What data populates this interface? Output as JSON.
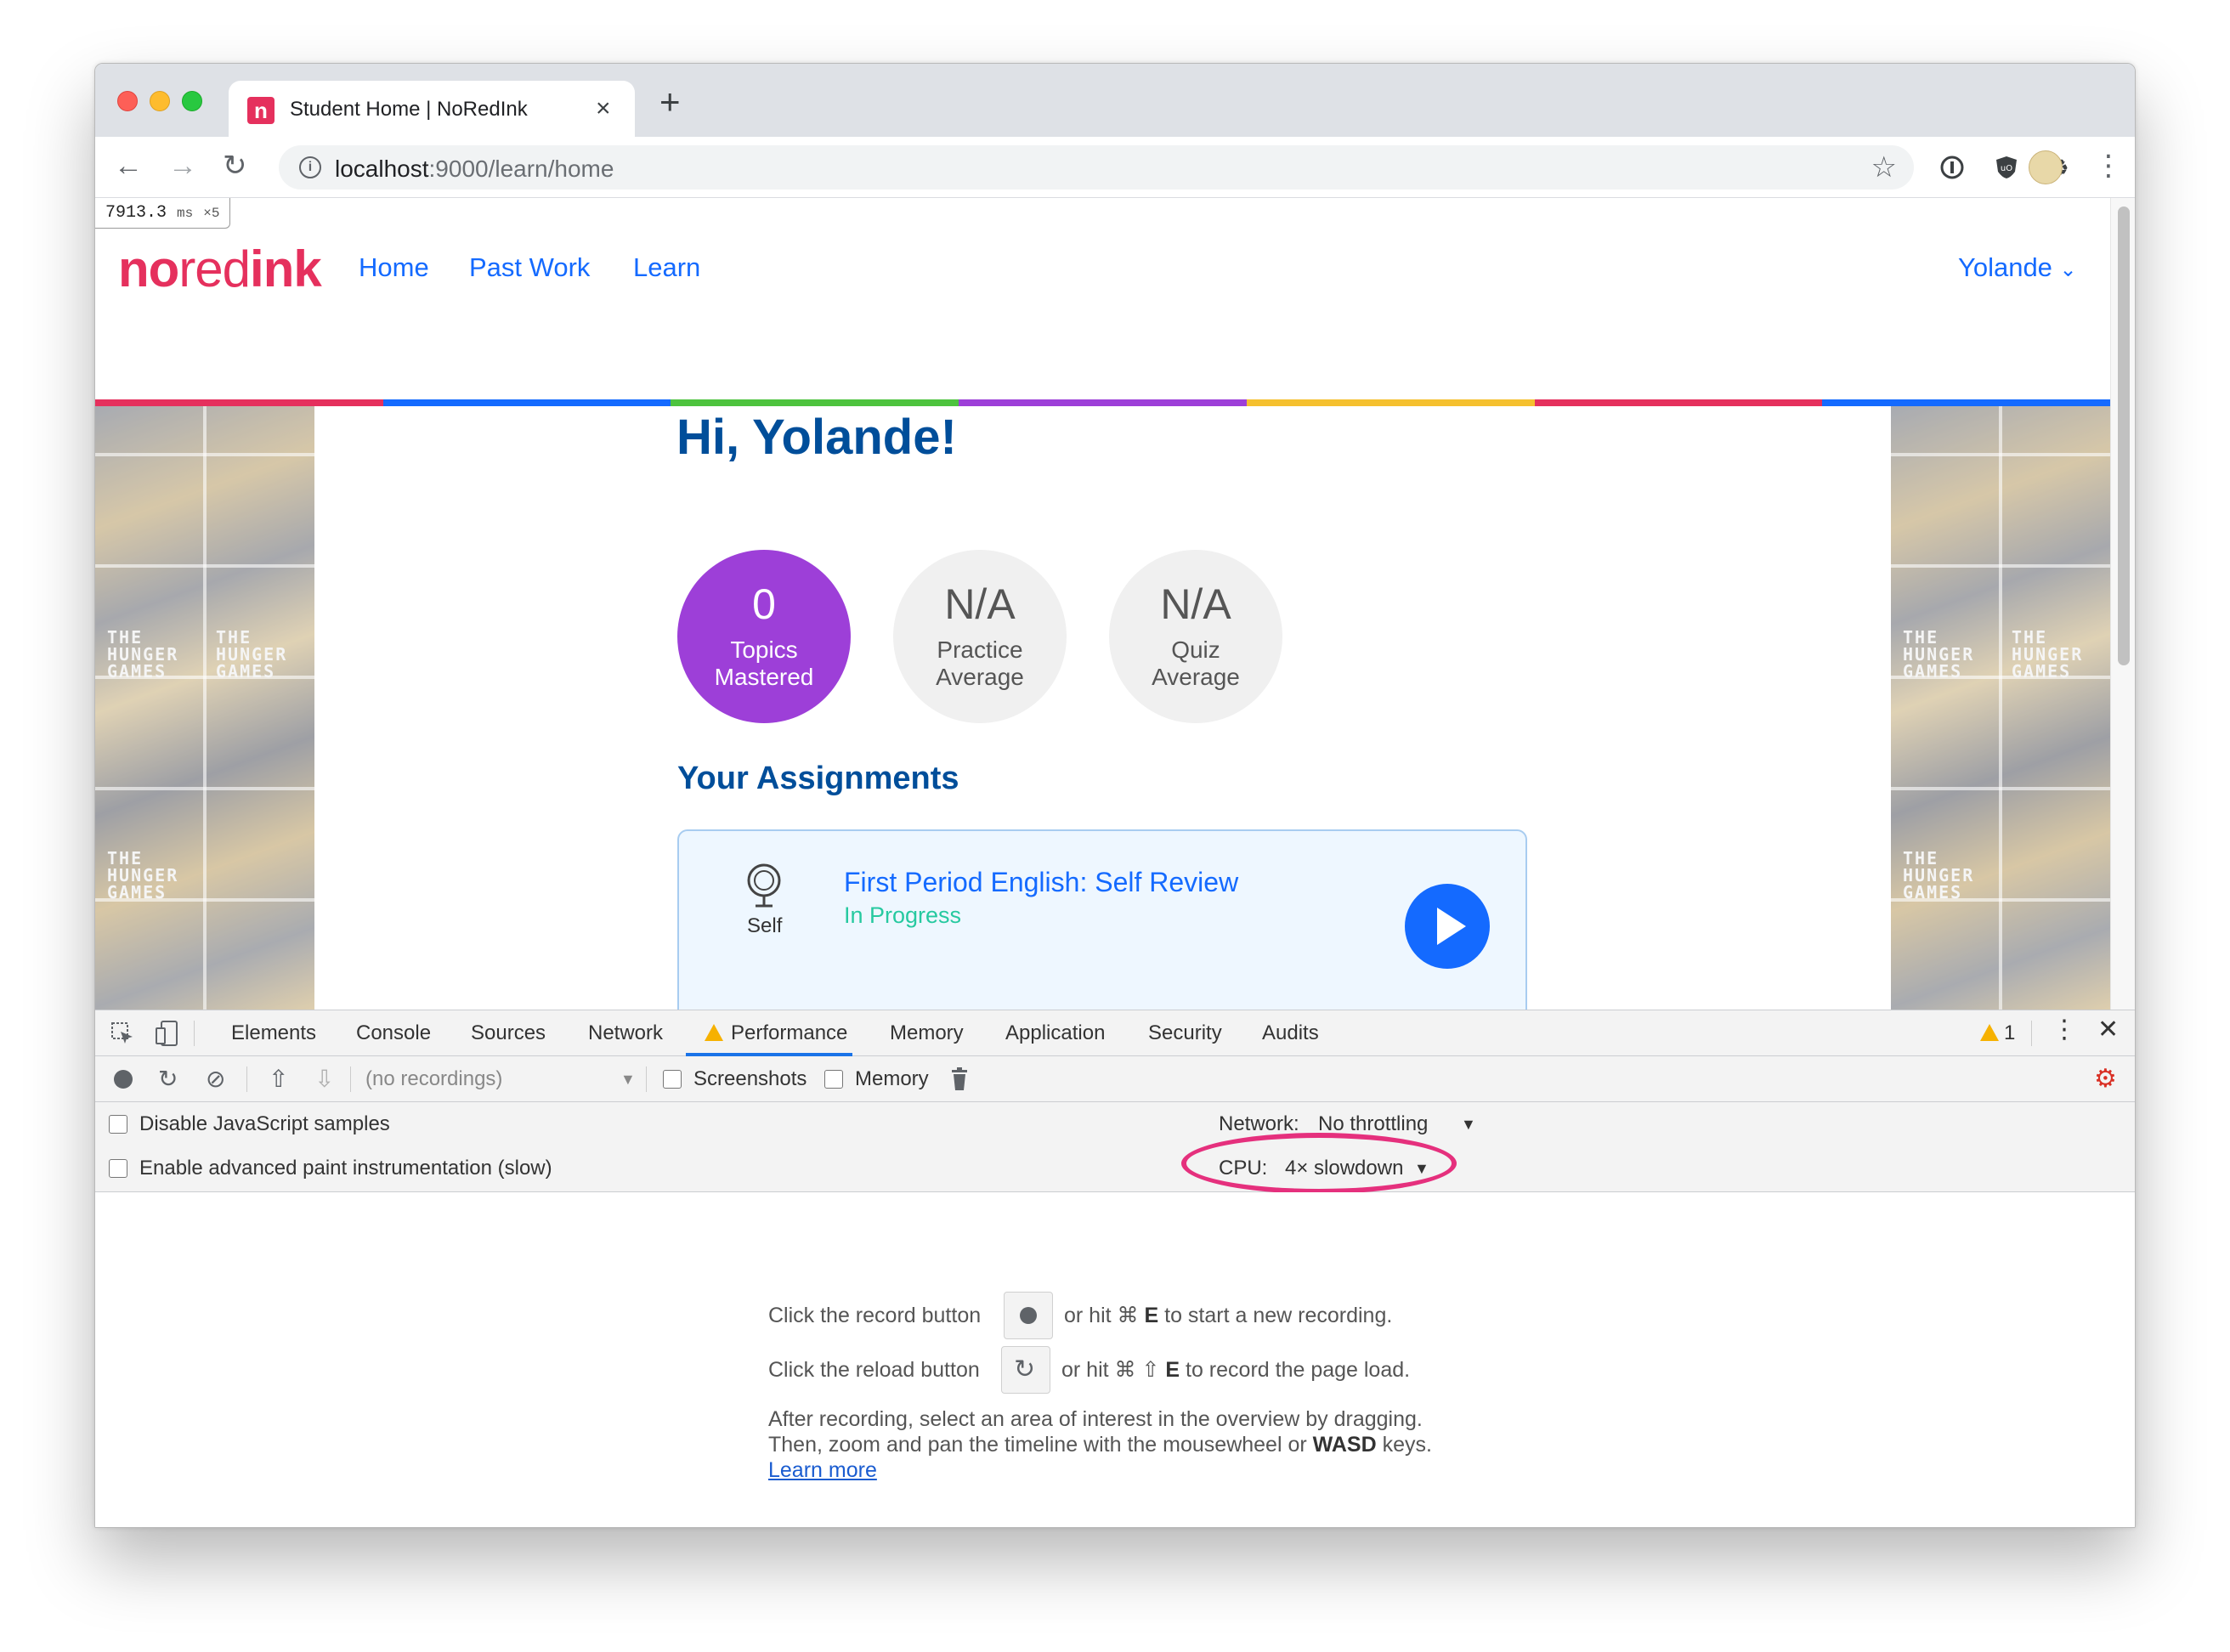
{
  "browser": {
    "tab": {
      "title": "Student Home | NoRedInk",
      "favicon": "n",
      "close": "×"
    },
    "new_tab": "+",
    "url": {
      "host": "localhost",
      "path": ":9000/learn/home"
    }
  },
  "page": {
    "timing": {
      "value": "7913.3",
      "unit": "ms",
      "multiplier": "×5"
    },
    "logo": {
      "part1": "no",
      "part2": "red",
      "part3": "ink"
    },
    "nav": [
      "Home",
      "Past Work",
      "Learn"
    ],
    "user": "Yolande",
    "greeting": "Hi, Yolande!",
    "stats": [
      {
        "value": "0",
        "line1": "Topics",
        "line2": "Mastered",
        "color": "#9d3fd8"
      },
      {
        "value": "N/A",
        "line1": "Practice",
        "line2": "Average",
        "color": "#f0f0f0"
      },
      {
        "value": "N/A",
        "line1": "Quiz",
        "line2": "Average",
        "color": "#f0f0f0"
      }
    ],
    "assignments_title": "Your Assignments",
    "assignment": {
      "type": "Self",
      "title": "First Period English: Self Review",
      "status": "In Progress"
    },
    "side_art": {
      "poster_text_line1": "THE",
      "poster_text_line2": "HUNGER",
      "poster_text_line3": "GAMES"
    },
    "rainbow_colors": [
      "#e5305d",
      "#146aff",
      "#4dc33e",
      "#9d3fd8",
      "#f5c02e",
      "#e5305d",
      "#146aff"
    ]
  },
  "devtools": {
    "tabs": [
      "Elements",
      "Console",
      "Sources",
      "Network",
      "Performance",
      "Memory",
      "Application",
      "Security",
      "Audits"
    ],
    "active_tab": "Performance",
    "warnings_count": "1",
    "recordings_placeholder": "(no recordings)",
    "screenshots_label": "Screenshots",
    "memory_label": "Memory",
    "settings": {
      "disable_js_samples": "Disable JavaScript samples",
      "advanced_paint": "Enable advanced paint instrumentation (slow)",
      "network_label": "Network:",
      "network_value": "No throttling",
      "cpu_label": "CPU:",
      "cpu_value": "4× slowdown"
    },
    "instructions": {
      "record_pre": "Click the record button",
      "record_post_a": "or hit ⌘",
      "record_key": "E",
      "record_post_b": "to start a new recording.",
      "reload_pre": "Click the reload button",
      "reload_post_a": "or hit ⌘ ⇧",
      "reload_key": "E",
      "reload_post_b": "to record the page load.",
      "after_line1": "After recording, select an area of interest in the overview by dragging.",
      "after_line2_pre": "Then, zoom and pan the timeline with the mousewheel or",
      "after_line2_key": "WASD",
      "after_line2_post": "keys.",
      "learn_more": "Learn more"
    },
    "highlight_color": "#e5307d"
  }
}
